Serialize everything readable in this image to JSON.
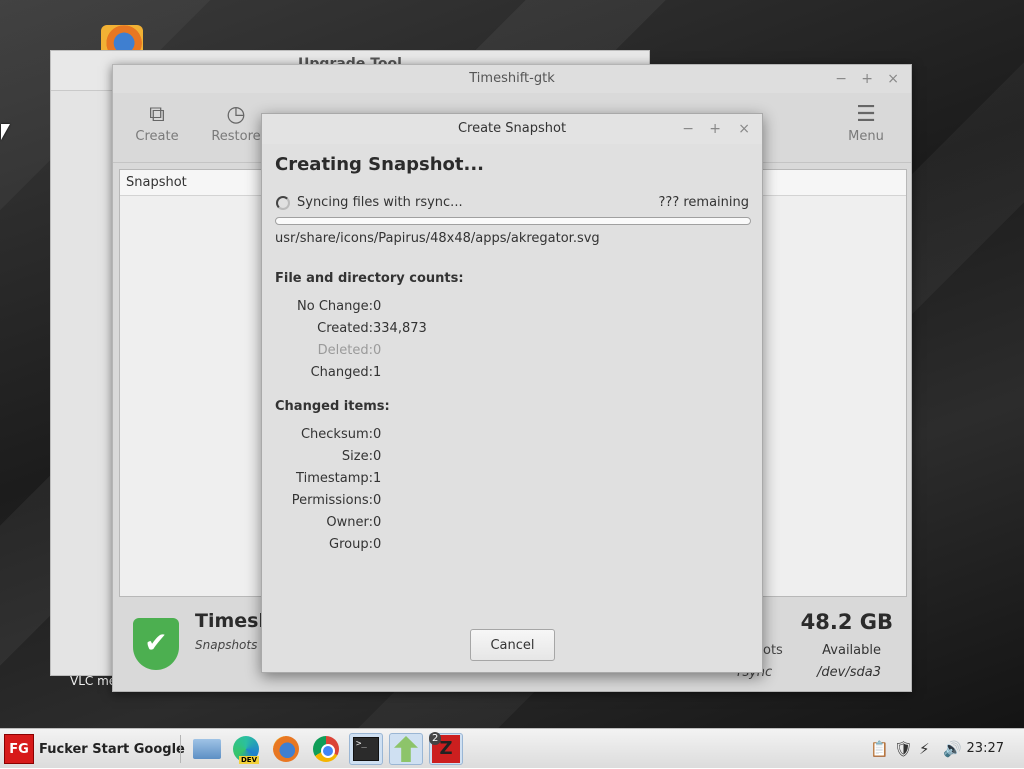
{
  "desktop": {
    "vlc_label": "VLC me"
  },
  "upgrade_window": {
    "title": "Upgrade Tool"
  },
  "timeshift_window": {
    "title": "Timeshift-gtk",
    "controls": {
      "minimize": "−",
      "maximize": "+",
      "close": "×"
    },
    "toolbar": [
      {
        "name": "create",
        "label": "Create",
        "icon": "create-snapshot-icon"
      },
      {
        "name": "restore",
        "label": "Restore",
        "icon": "clock-icon"
      },
      {
        "name": "menu",
        "label": "Menu",
        "icon": "hamburger-icon"
      }
    ],
    "list_header": "Snapshot",
    "status": {
      "title": "Timeshi",
      "subtitle": "Snapshots w",
      "size": "48.2 GB",
      "available": "Available",
      "device": "/dev/sda3",
      "shots_fragment": "ots",
      "rsync_fragment": "rsync"
    }
  },
  "dialog": {
    "title": "Create Snapshot",
    "controls": {
      "minimize": "−",
      "maximize": "+",
      "close": "×"
    },
    "heading": "Creating Snapshot...",
    "sync_label": "Syncing files with rsync...",
    "remaining": "??? remaining",
    "progress": 0.0,
    "current_file": "usr/share/icons/Papirus/48x48/apps/akregator.svg",
    "file_counts": {
      "title": "File and directory counts:",
      "rows": [
        {
          "label": "No Change:",
          "value": "0"
        },
        {
          "label": "Created:",
          "value": "334,873"
        },
        {
          "label": "Deleted:",
          "value": "0"
        },
        {
          "label": "Changed:",
          "value": "1"
        }
      ]
    },
    "changed_items": {
      "title": "Changed items:",
      "rows": [
        {
          "label": "Checksum:",
          "value": "0"
        },
        {
          "label": "Size:",
          "value": "0"
        },
        {
          "label": "Timestamp:",
          "value": "1"
        },
        {
          "label": "Permissions:",
          "value": "0"
        },
        {
          "label": "Owner:",
          "value": "0"
        },
        {
          "label": "Group:",
          "value": "0"
        }
      ]
    },
    "cancel_label": "Cancel"
  },
  "taskbar": {
    "start_logo": "FG",
    "start_label": "Fucker Start Google",
    "edge_badge": "DEV",
    "terminal_glyph": ">_",
    "timeshift_badge": "2",
    "clock": "23:27",
    "tray": [
      "clipboard-icon",
      "shield-icon",
      "network-icon",
      "volume-icon"
    ]
  }
}
